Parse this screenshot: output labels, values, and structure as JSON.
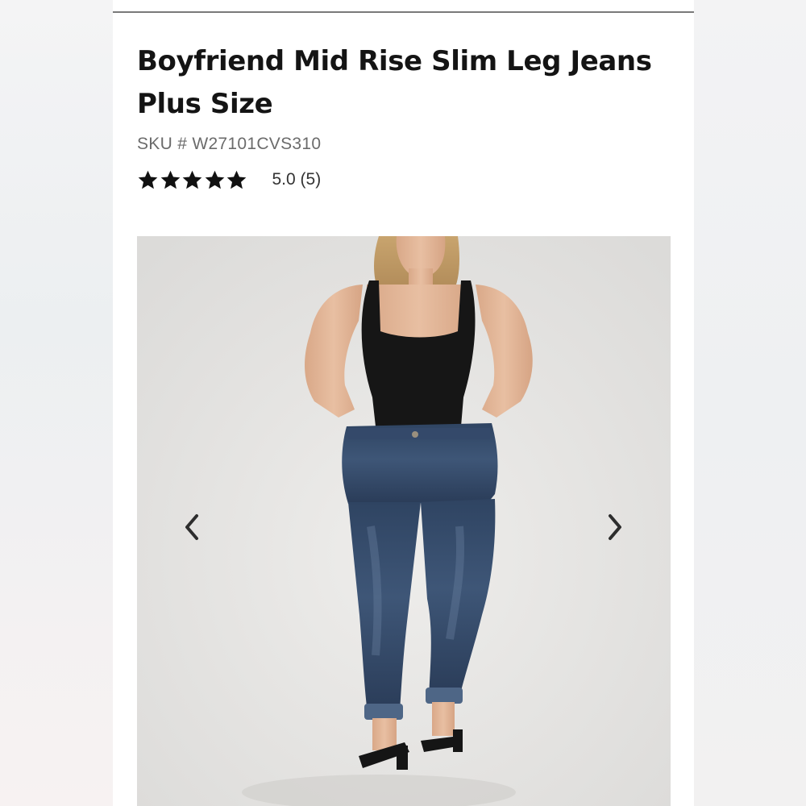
{
  "product": {
    "title": "Boyfriend Mid Rise Slim Leg Jeans Plus Size",
    "sku": "SKU # W27101CVS310",
    "rating": {
      "stars": 5,
      "max_stars": 5,
      "text": "5.0 (5)"
    }
  },
  "gallery": {
    "image": "model-wearing-jeans-photo",
    "prev_icon": "chevron-left-icon",
    "next_icon": "chevron-right-icon"
  },
  "colors": {
    "text": "#141414",
    "sku": "#6b6b6b",
    "star": "#111111",
    "background": "#ffffff"
  }
}
